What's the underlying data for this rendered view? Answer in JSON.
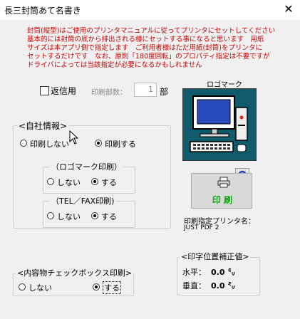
{
  "window": {
    "title": "長三封筒あて名書き",
    "close_glyph": "✕"
  },
  "notice": "封筒(縦型)はご使用のプリンタマニュアルに従ってプリンタにセットしてください\n基本的には封筒の底から排出される様にセットする事になると思います　用紙\nサイズは本アプリ側で指定します　ご利用者様はただ用紙(封筒)をプリンタに\nセットするだけです　なお、原則「180度回転」のプロパティ指定は不要ですが\nドライバによっては当該指定が必要になるかもしれません",
  "return_mail": {
    "label": "返信用",
    "checked": false
  },
  "copies": {
    "label": "印刷部数：",
    "value": "1",
    "unit": "部"
  },
  "logo": {
    "title": "ロゴマーク",
    "icon": "computer-icon"
  },
  "company_info": {
    "title": "<自社情報>",
    "options": [
      "印刷しない",
      "印刷する"
    ],
    "selected": 1
  },
  "logo_print": {
    "title": "（ロゴマーク印刷）",
    "options": [
      "しない",
      "する"
    ],
    "selected": 1
  },
  "tel_fax_print": {
    "title": "（TEL／FAX印刷)",
    "options": [
      "しない",
      "する"
    ],
    "selected": 1
  },
  "print_button": {
    "label": "印 刷",
    "icon": "printer-icon"
  },
  "reset_icon": "refresh-icon",
  "printer": {
    "label": "印刷指定プリンタ名：",
    "name": "JUST PDF 2"
  },
  "content_checkbox": {
    "title": "<内容物チェックボックス印刷>",
    "options": [
      "しない",
      "する"
    ],
    "selected": 1
  },
  "position_correction": {
    "title": "<印字位置補正値>",
    "horizontal_label": "水平：",
    "horizontal_value": "0.0 ㍉",
    "vertical_label": "垂直：",
    "vertical_value": "0.0 ㍉"
  },
  "colors": {
    "notice": "#cc0000",
    "print_text": "#1a9c1a",
    "logo_bg": "#0f5b6b"
  }
}
